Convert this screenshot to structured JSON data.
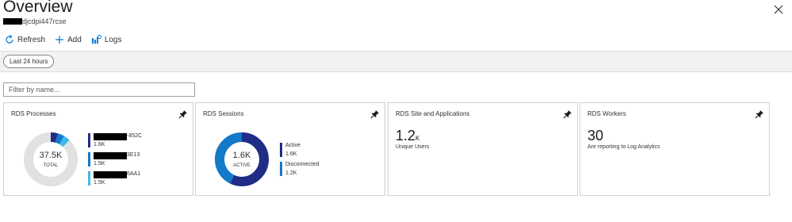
{
  "header": {
    "title": "Overview",
    "subtitle": "djcdpi447rcse",
    "close_icon": "close-icon"
  },
  "toolbar": {
    "refresh_label": "Refresh",
    "add_label": "Add",
    "logs_label": "Logs"
  },
  "time_filter": {
    "label": "Last 24 hours"
  },
  "search": {
    "placeholder": "Filter by name..."
  },
  "tiles": {
    "processes": {
      "title": "RDS Processes",
      "center_value": "37.5K",
      "center_label": "TOTAL",
      "legend": [
        {
          "name_suffix": "-852C",
          "value": "1.6K",
          "color": "#1f2d86"
        },
        {
          "name_suffix": "3E13",
          "value": "1.5K",
          "color": "#1379c9"
        },
        {
          "name_suffix": "6AA1",
          "value": "1.5K",
          "color": "#3fb9e9"
        }
      ]
    },
    "sessions": {
      "title": "RDS Sessions",
      "center_value": "1.6K",
      "center_label": "ACTIVE",
      "legend": [
        {
          "name": "Active",
          "value": "1.6K",
          "color": "#1f2d86"
        },
        {
          "name": "Disconnected",
          "value": "1.2K",
          "color": "#1379c9"
        }
      ]
    },
    "site": {
      "title": "RDS Site and Applications",
      "value": "1.2",
      "unit": "K",
      "caption": "Unique Users"
    },
    "workers": {
      "title": "RDS Workers",
      "value": "30",
      "caption": "Are reporting to Log Analytics"
    }
  },
  "chart_data": [
    {
      "type": "pie",
      "title": "RDS Processes",
      "categories": [
        "-852C",
        "3E13",
        "6AA1"
      ],
      "values": [
        1.6,
        1.5,
        1.5
      ],
      "total": 37.5
    },
    {
      "type": "pie",
      "title": "RDS Sessions",
      "categories": [
        "Active",
        "Disconnected"
      ],
      "values": [
        1.6,
        1.2
      ]
    }
  ]
}
